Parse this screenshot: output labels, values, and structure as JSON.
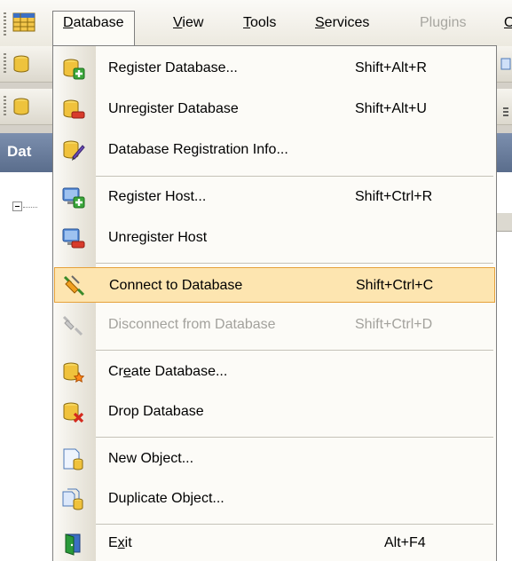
{
  "menubar": {
    "menus": [
      {
        "text": "Database",
        "ul": "D",
        "rest": "atabase",
        "active": true
      },
      {
        "text": "View",
        "ul": "V",
        "rest": "iew"
      },
      {
        "text": "Tools",
        "ul": "T",
        "rest": "ools"
      },
      {
        "text": "Services",
        "ul": "S",
        "rest": "ervices"
      },
      {
        "text": "Plugins",
        "ul": "",
        "rest": "Plugins",
        "disabled": true
      },
      {
        "text": "O",
        "ul": "O",
        "rest": ""
      }
    ]
  },
  "panel": {
    "title": "Dat"
  },
  "database_menu": {
    "items": [
      {
        "label": "Register Database...",
        "shortcut": "Shift+Alt+R",
        "icon": "register-database-icon"
      },
      {
        "label": "Unregister Database",
        "shortcut": "Shift+Alt+U",
        "icon": "unregister-database-icon"
      },
      {
        "label": "Database Registration Info...",
        "shortcut": "",
        "icon": "database-registration-info-icon"
      },
      {
        "label": "Register Host...",
        "shortcut": "Shift+Ctrl+R",
        "icon": "register-host-icon"
      },
      {
        "label": "Unregister Host",
        "shortcut": "",
        "icon": "unregister-host-icon"
      },
      {
        "label": "Connect to Database",
        "shortcut": "Shift+Ctrl+C",
        "icon": "connect-plug-icon",
        "highlighted": true
      },
      {
        "label": "Disconnect from Database",
        "shortcut": "Shift+Ctrl+D",
        "icon": "disconnect-plug-icon",
        "disabled": true
      },
      {
        "label_pre": "Cr",
        "label_ul": "e",
        "label_post": "ate Database...",
        "shortcut": "",
        "icon": "create-database-icon"
      },
      {
        "label": "Drop Database",
        "shortcut": "",
        "icon": "drop-database-icon"
      },
      {
        "label": "New Object...",
        "shortcut": "",
        "icon": "new-object-icon"
      },
      {
        "label": "Duplicate Object...",
        "shortcut": "",
        "icon": "duplicate-object-icon"
      },
      {
        "label_pre": "E",
        "label_ul": "x",
        "label_post": "it",
        "shortcut": "Alt+F4",
        "icon": "exit-door-icon"
      }
    ]
  }
}
